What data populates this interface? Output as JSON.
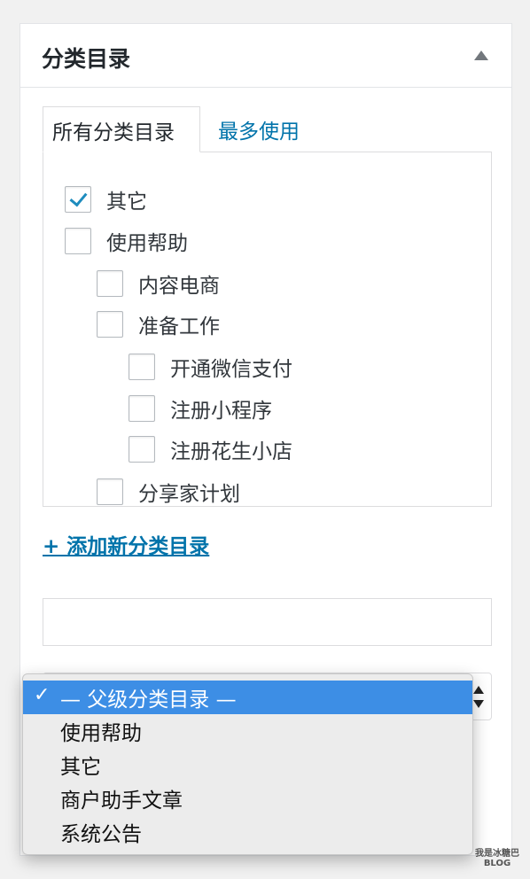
{
  "panel": {
    "title": "分类目录"
  },
  "tabs": {
    "all_label": "所有分类目录",
    "most_used_label": "最多使用"
  },
  "categories": [
    {
      "label": "其它",
      "checked": true,
      "level": 0
    },
    {
      "label": "使用帮助",
      "checked": false,
      "level": 0
    },
    {
      "label": "内容电商",
      "checked": false,
      "level": 1
    },
    {
      "label": "准备工作",
      "checked": false,
      "level": 1
    },
    {
      "label": "开通微信支付",
      "checked": false,
      "level": 2
    },
    {
      "label": "注册小程序",
      "checked": false,
      "level": 2
    },
    {
      "label": "注册花生小店",
      "checked": false,
      "level": 2
    },
    {
      "label": "分享家计划",
      "checked": false,
      "level": 1
    }
  ],
  "add_new": {
    "link_label": "+ 添加新分类目录",
    "name_value": "",
    "parent_select": {
      "selected": "— 父级分类目录 —",
      "options": [
        "— 父级分类目录 —",
        "使用帮助",
        "其它",
        "商户助手文章",
        "系统公告"
      ]
    }
  },
  "watermark": {
    "line1": "我是冰糖巴",
    "line2": "BLOG"
  },
  "colors": {
    "link": "#0073aa",
    "check": "#1e8cbe",
    "dropdown_highlight": "#3d8ee5"
  }
}
